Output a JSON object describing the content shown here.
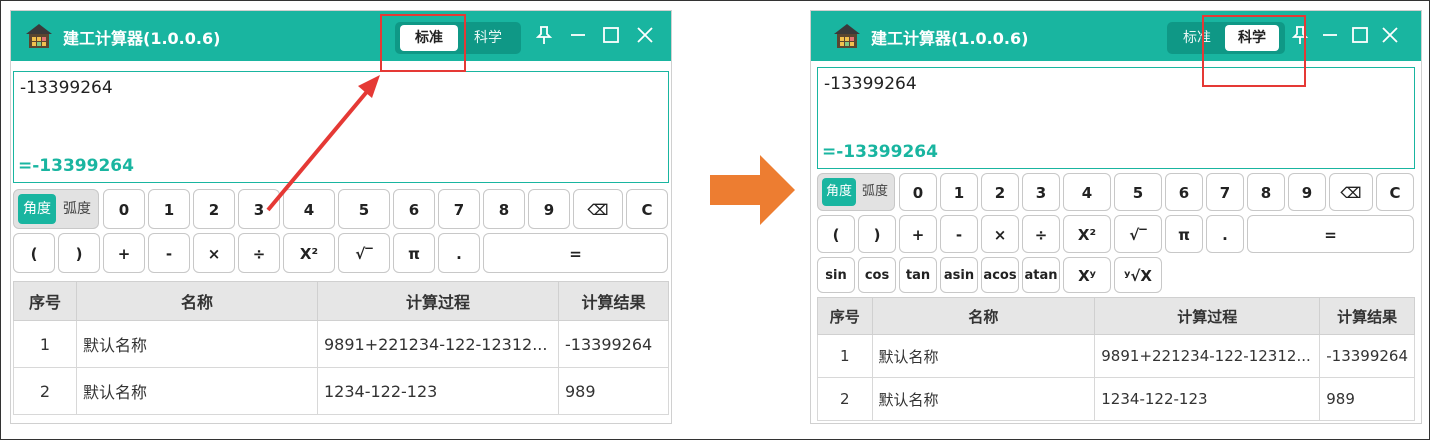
{
  "left": {
    "title": "建工计算器(1.0.0.6)",
    "modes": [
      "标准",
      "科学"
    ],
    "active_mode": "标准",
    "expression": "-13399264",
    "result": "=-13399264",
    "angle_units": [
      "角度",
      "弧度"
    ],
    "keys_row1": [
      "0",
      "1",
      "2",
      "3",
      "4",
      "5",
      "6",
      "7",
      "8",
      "9",
      "⌫",
      "C"
    ],
    "keys_row2": [
      "(",
      ")",
      "+",
      "-",
      "×",
      "÷",
      "X²",
      "√‾",
      "π",
      ".",
      "="
    ],
    "table": {
      "headers": [
        "序号",
        "名称",
        "计算过程",
        "计算结果"
      ],
      "rows": [
        [
          "1",
          "默认名称",
          "9891+221234-122-12312...",
          "-13399264"
        ],
        [
          "2",
          "默认名称",
          "1234-122-123",
          "989"
        ]
      ]
    }
  },
  "right": {
    "title": "建工计算器(1.0.0.6)",
    "modes": [
      "标准",
      "科学"
    ],
    "active_mode": "科学",
    "expression": "-13399264",
    "result": "=-13399264",
    "angle_units": [
      "角度",
      "弧度"
    ],
    "keys_row1": [
      "0",
      "1",
      "2",
      "3",
      "4",
      "5",
      "6",
      "7",
      "8",
      "9",
      "⌫",
      "C"
    ],
    "keys_row2": [
      "(",
      ")",
      "+",
      "-",
      "×",
      "÷",
      "X²",
      "√‾",
      "π",
      ".",
      "="
    ],
    "keys_row3": [
      "sin",
      "cos",
      "tan",
      "asin",
      "acos",
      "atan",
      "Xʸ",
      "ʸ√X"
    ],
    "table": {
      "headers": [
        "序号",
        "名称",
        "计算过程",
        "计算结果"
      ],
      "rows": [
        [
          "1",
          "默认名称",
          "9891+221234-122-12312...",
          "-13399264"
        ],
        [
          "2",
          "默认名称",
          "1234-122-123",
          "989"
        ]
      ]
    }
  },
  "colors": {
    "accent": "#19b5a0",
    "arrow": "#ed7d31",
    "highlight": "#e53935"
  }
}
